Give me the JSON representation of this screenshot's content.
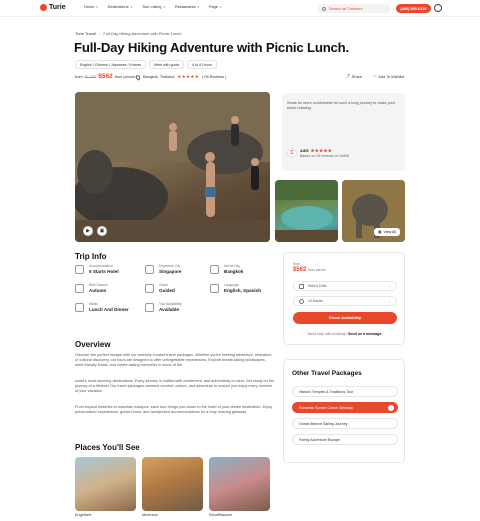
{
  "brand": {
    "name": "Turie"
  },
  "nav": {
    "items": [
      {
        "label": "Home"
      },
      {
        "label": "Destinations"
      },
      {
        "label": "Tour Listing"
      },
      {
        "label": "Restaurants"
      },
      {
        "label": "Page"
      }
    ],
    "search_placeholder": "Search for Treasure",
    "phone": "(406) 555-0120"
  },
  "breadcrumb": {
    "home": "Turie Travel",
    "current": "Full-Day Hiking Adventure with Picnic Lunch"
  },
  "tour": {
    "title": "Full-Day Hiking Adventure with Picnic Lunch.",
    "tags": [
      "English / Chinese / Japanese / Korean",
      "Meet with guide",
      "6 to 8 Hours"
    ],
    "price_from": "from",
    "old_price": "$1,700",
    "price": "$562",
    "per": "from person",
    "location": "Bangkok, Thailand",
    "stars": "★★★★★",
    "review_count": "( 05 Reviews )",
    "share": "Share",
    "wishlist": "Add To Wishlist"
  },
  "gallery": {
    "view_all": "View All"
  },
  "review_card": {
    "text": "Seats be more comfortable for such a long journey to make your travel relaxing.",
    "score": "4.8/5",
    "stars": "★★★★★",
    "based_on": "Based on 29 reviews on Getlift"
  },
  "trip_info": {
    "heading": "Trip Info",
    "items": [
      {
        "label": "Accommodation",
        "value": "5 Starts Hotel"
      },
      {
        "label": "Departure City",
        "value": "Singapore"
      },
      {
        "label": "Arrival City",
        "value": "Bangkok"
      },
      {
        "label": "Best Season",
        "value": "Autumn"
      },
      {
        "label": "Guide",
        "value": "Guided"
      },
      {
        "label": "Language",
        "value": "English, Spanish"
      },
      {
        "label": "Meals",
        "value": "Lunch And Dinner"
      },
      {
        "label": "Tour Availability",
        "value": "Available"
      }
    ]
  },
  "overview": {
    "heading": "Overview",
    "p1": "Discover the perfect escape with our carefully curated travel packages. Whether you're seeking adventure, relaxation, or cultural discovery, our tours are designed to offer unforgettable experiences. Explore breath-taking landscapes, meet friendly locals, and create lasting memories in some of the",
    "p2": "world's most stunning destinations. Every journey is crafted with excitement, and authenticity in mind. Get ready for the journey of a lifetime! Our travel packages combine comfort, culture, and adventure to ensure you enjoy every moment of your vacation.",
    "p3": "From tropical beaches to mountain escapes, each tour brings you closer to the heart of your dream destination. Enjoy personalized experiences, guided tours, and handpicked accommodations for a truly relaxing getaway."
  },
  "places": {
    "heading": "Places You'll See",
    "items": [
      {
        "label": "Engelbert"
      },
      {
        "label": "Montreux"
      },
      {
        "label": "Schaffhausen"
      }
    ]
  },
  "booking": {
    "from": "from",
    "price": "$562",
    "per": "from person",
    "date_placeholder": "Select Date",
    "adults": "12 Adults",
    "check_btn": "Check Availability",
    "help": "Need help with booking?",
    "help_link": "Send us a message."
  },
  "other_packages": {
    "heading": "Other Travel Packages",
    "items": [
      {
        "label": "Historic Temples & Traditions Tour"
      },
      {
        "label": "Romantic Sunset Cruise Getaway"
      },
      {
        "label": "Ocean Breeze Sailing Journey"
      },
      {
        "label": "Family Adventure Escape"
      }
    ],
    "active_index": 1
  },
  "colors": {
    "accent": "#e8492d"
  }
}
